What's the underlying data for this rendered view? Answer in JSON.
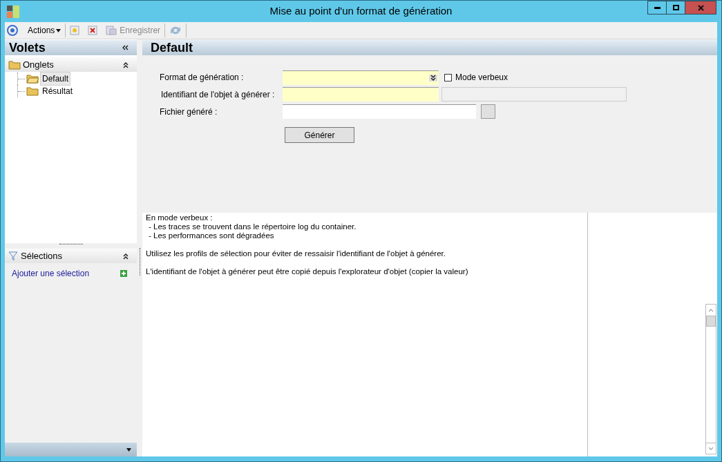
{
  "window": {
    "title": "Mise au point d'un format de génération"
  },
  "toolbar": {
    "actions_label": "Actions",
    "save_label": "Enregistrer"
  },
  "sidebar": {
    "title": "Volets",
    "onglets": {
      "title": "Onglets",
      "expanded": true,
      "items": [
        {
          "label": "Default",
          "selected": true
        },
        {
          "label": "Résultat",
          "selected": false
        }
      ]
    },
    "selections": {
      "title": "Sélections",
      "expanded": true,
      "add_link": "Ajouter une sélection"
    }
  },
  "main": {
    "title": "Default",
    "form": {
      "format_label": "Format de génération  :",
      "mode_verbeux": {
        "label": "Mode verbeux",
        "checked": false
      },
      "identifiant_label": "Identifiant de l'objet à générer :",
      "fichier_label": "Fichier généré :",
      "generate_button": "Générer"
    },
    "info_paragraphs": [
      [
        "En mode verbeux :",
        "- Les traces se trouvent dans le répertoire log du container.",
        "- Les performances sont dégradées"
      ],
      [
        "Utilisez les profils de sélection pour éviter de ressaisir l'identifiant de l'objet à générer."
      ],
      [
        "L'identifiant de l'objet à générer peut être copié depuis l'explorateur d'objet (copier la valeur)"
      ]
    ]
  }
}
